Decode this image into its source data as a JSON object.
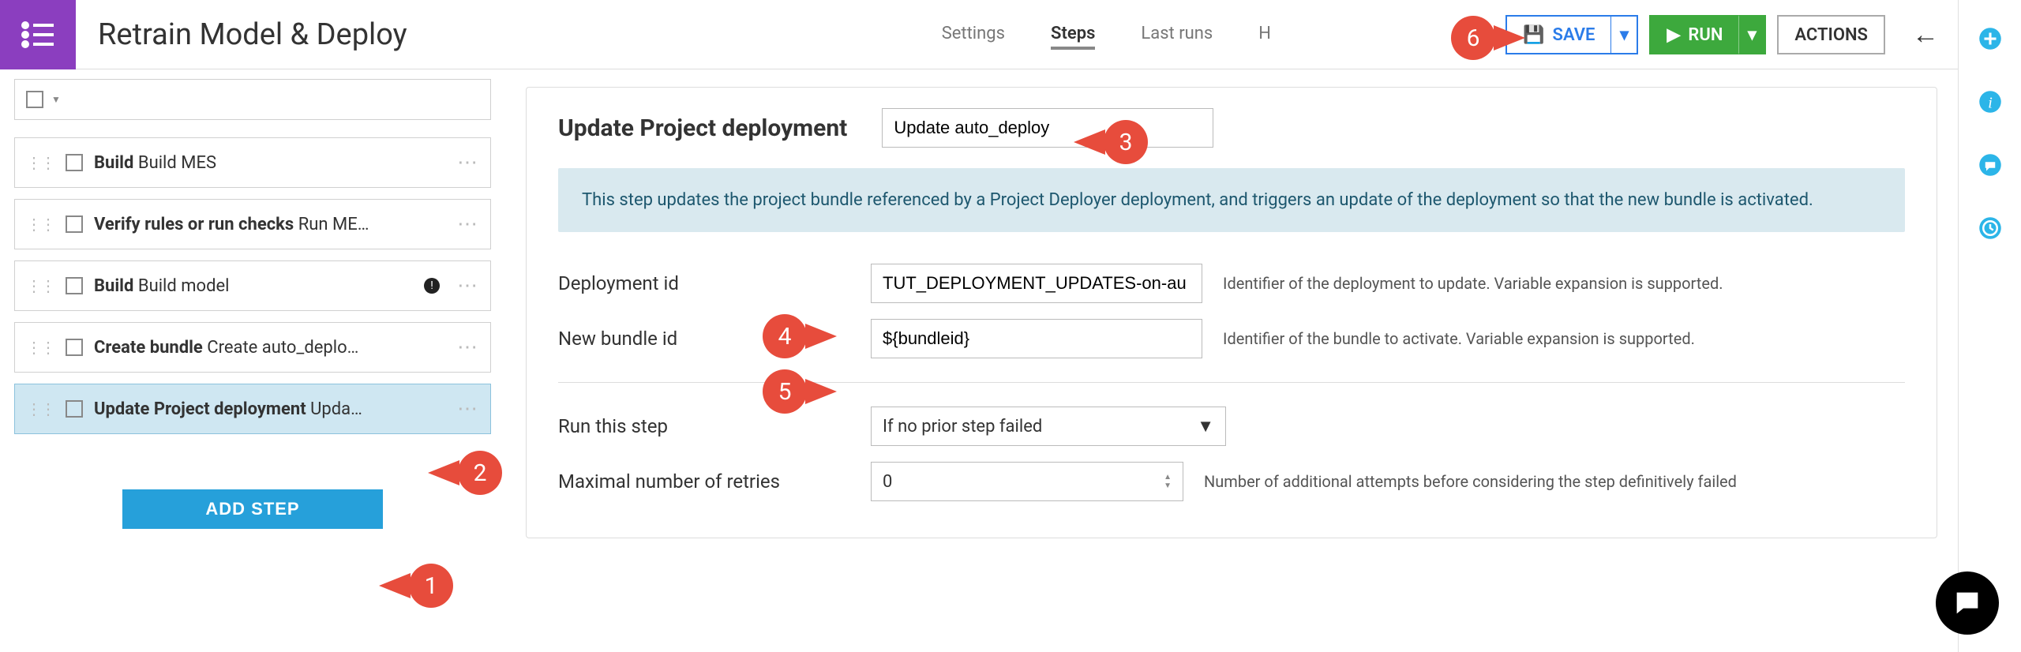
{
  "pageTitle": "Retrain Model & Deploy",
  "nav": {
    "settings": "Settings",
    "steps": "Steps",
    "lastRuns": "Last runs",
    "history": "H"
  },
  "buttons": {
    "save": "SAVE",
    "run": "RUN",
    "actions": "ACTIONS",
    "addStep": "ADD STEP"
  },
  "stepList": [
    {
      "prefix": "Build",
      "suffix": " Build MES"
    },
    {
      "prefix": "Verify rules or run checks",
      "suffix": " Run ME…"
    },
    {
      "prefix": "Build",
      "suffix": " Build model"
    },
    {
      "prefix": "Create bundle",
      "suffix": " Create auto_deplo…"
    },
    {
      "prefix": "Update Project deployment",
      "suffix": " Upda…"
    }
  ],
  "panel": {
    "heading": "Update Project deployment",
    "nameValue": "Update auto_deploy",
    "banner": "This step updates the project bundle referenced by a Project Deployer deployment, and triggers an update of the deployment so that the new bundle is activated.",
    "deploymentId": {
      "label": "Deployment id",
      "value": "TUT_DEPLOYMENT_UPDATES-on-au",
      "hint": "Identifier of the deployment to update. Variable expansion is supported."
    },
    "bundleId": {
      "label": "New bundle id",
      "value": "${bundleid}",
      "hint": "Identifier of the bundle to activate. Variable expansion is supported."
    },
    "runStep": {
      "label": "Run this step",
      "value": "If no prior step failed"
    },
    "retries": {
      "label": "Maximal number of retries",
      "value": "0",
      "hint": "Number of additional attempts before considering the step definitively failed"
    }
  },
  "annotations": {
    "b1": "1",
    "b2": "2",
    "b3": "3",
    "b4": "4",
    "b5": "5",
    "b6": "6"
  }
}
